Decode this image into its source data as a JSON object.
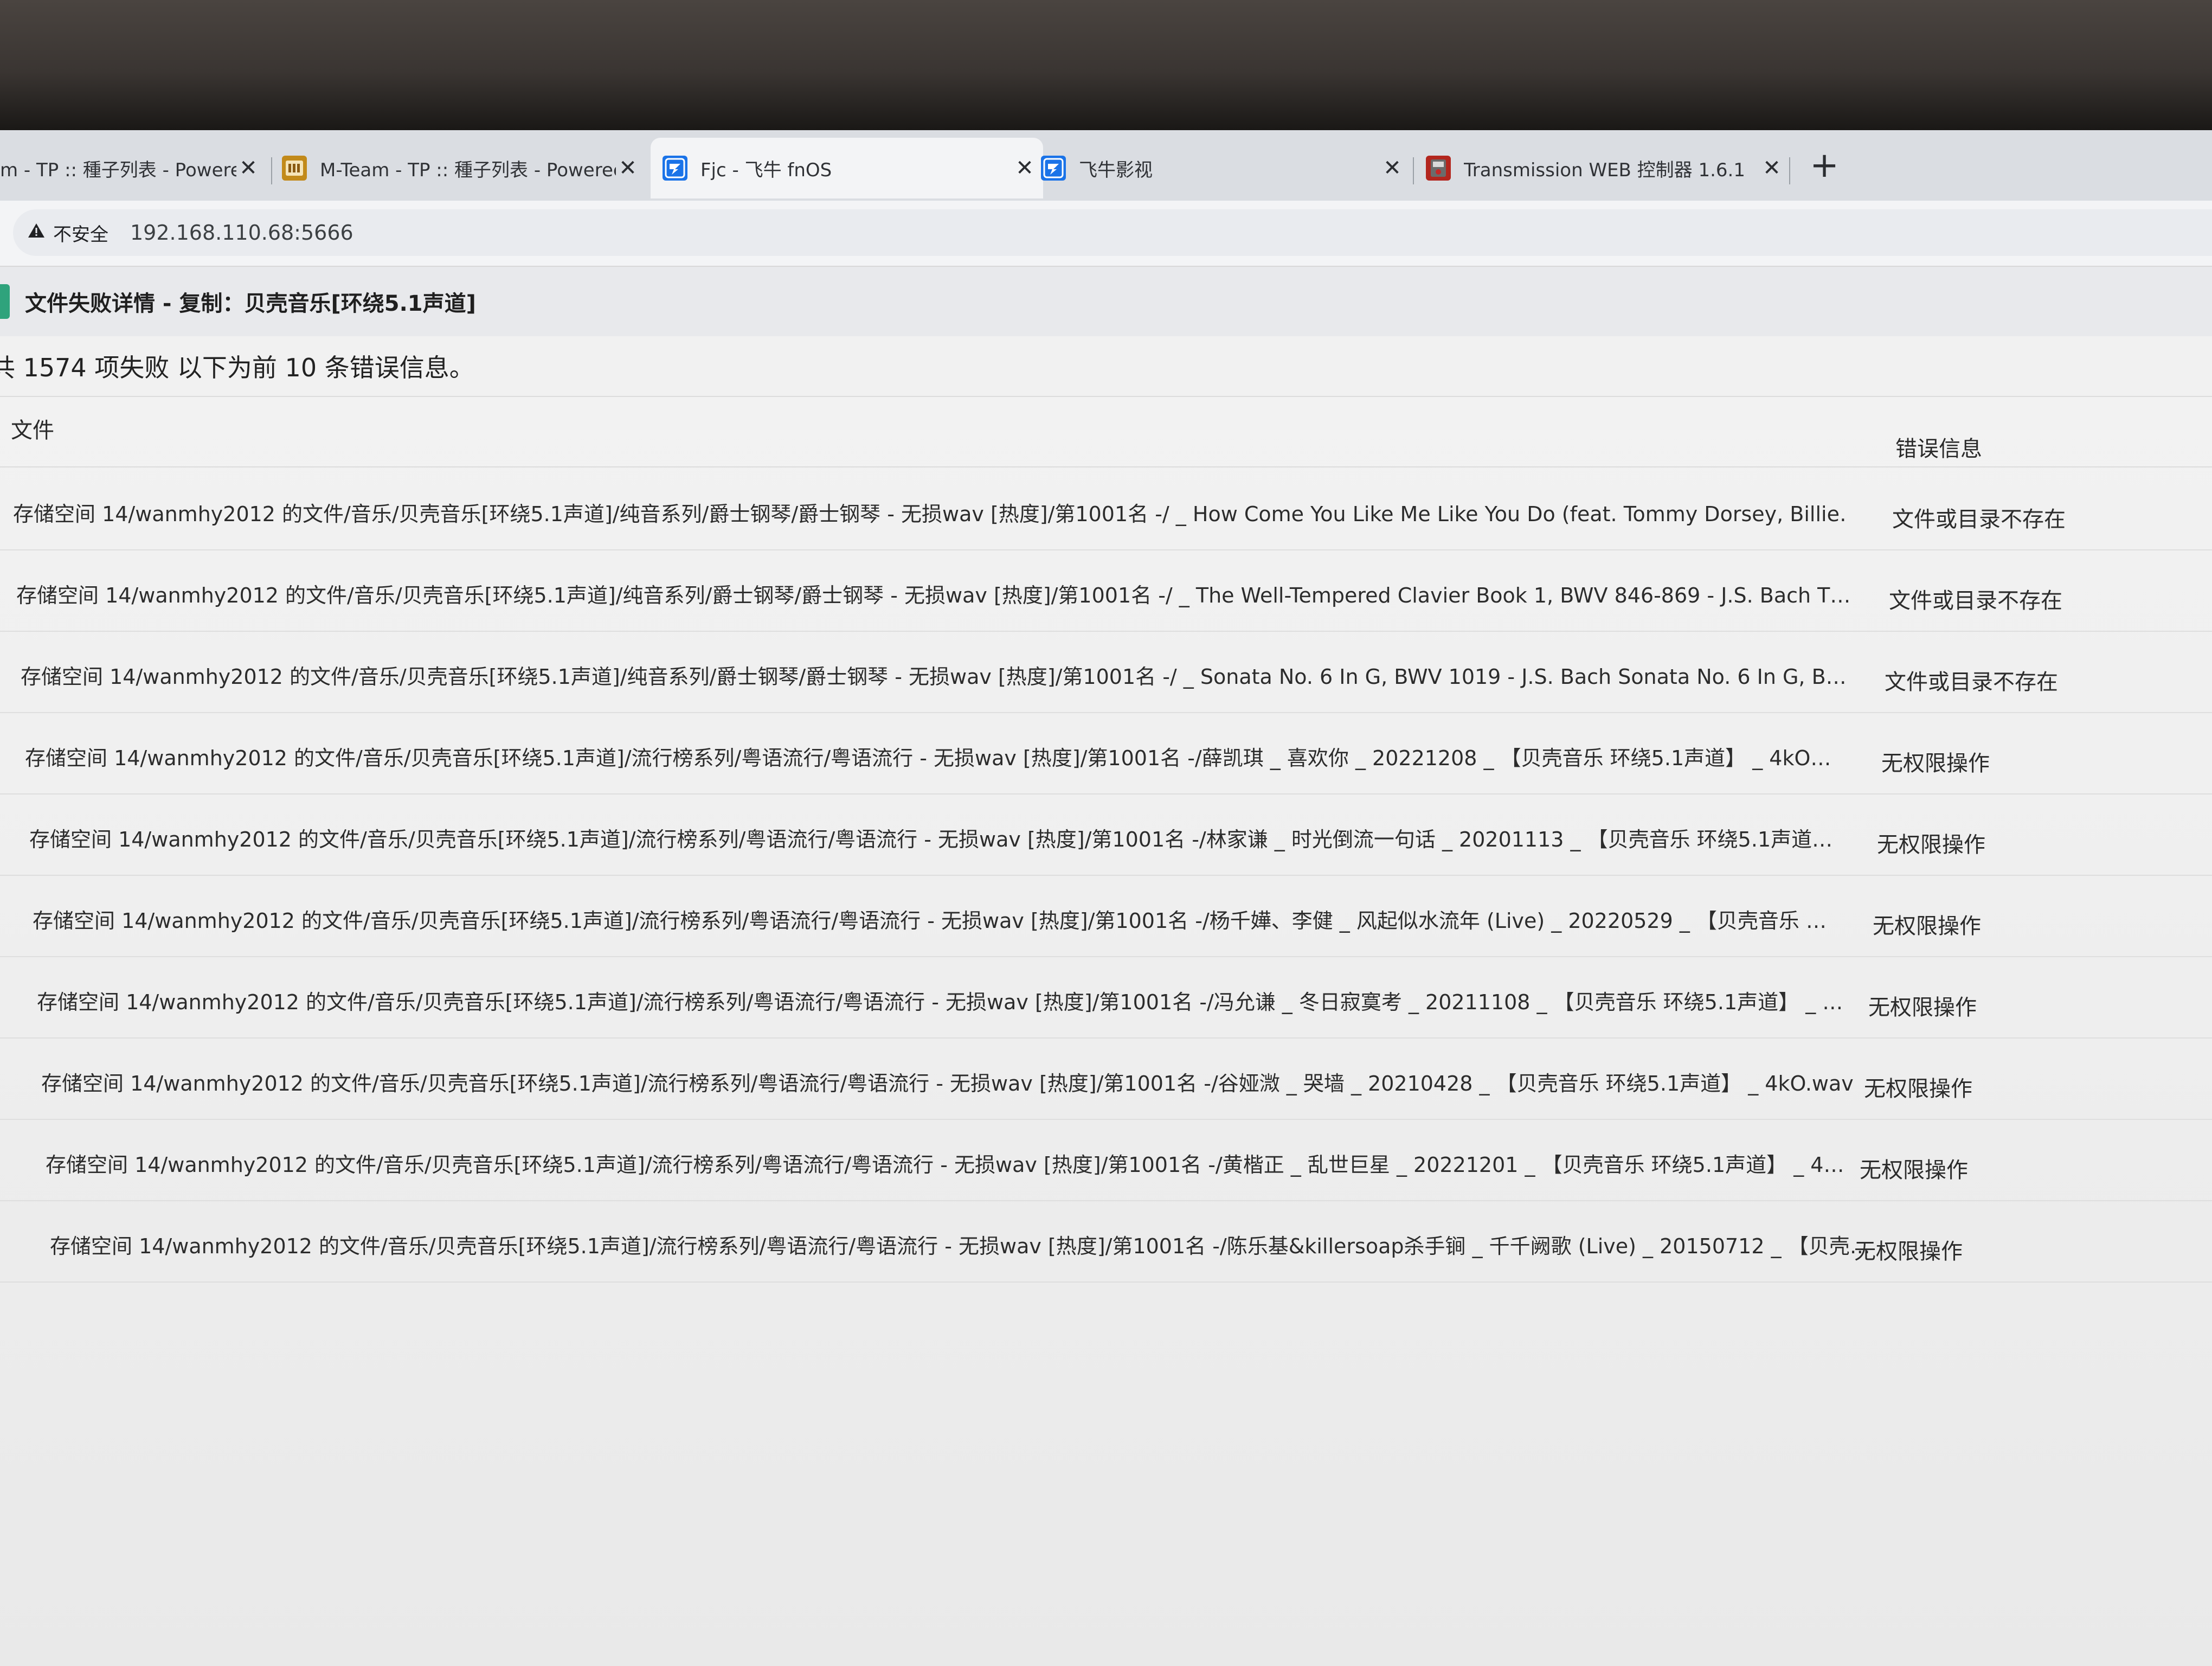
{
  "browser": {
    "tabs": [
      {
        "title": "m - TP :: 種子列表 - Powerec",
        "active": false,
        "icon": "mteam-favicon"
      },
      {
        "title": "M-Team - TP :: 種子列表 - Powerec",
        "active": false,
        "icon": "mteam-favicon"
      },
      {
        "title": "Fjc - 飞牛 fnOS",
        "active": true,
        "icon": "fnos-favicon"
      },
      {
        "title": "飞牛影视",
        "active": false,
        "icon": "fnos-favicon"
      },
      {
        "title": "Transmission WEB 控制器 1.6.1",
        "active": false,
        "icon": "transmission-favicon"
      }
    ],
    "new_tab_label": "+",
    "close_glyph": "✕",
    "security_label": "不安全",
    "url": "192.168.110.68:5666"
  },
  "dialog": {
    "title": "文件失败详情 - 复制：贝壳音乐[环绕5.1声道]",
    "summary": "共 1574 项失败 以下为前 10 条错误信息。",
    "columns": {
      "file": "文件",
      "error": "错误信息"
    },
    "rows": [
      {
        "file": "存储空间 14/wanmhy2012 的文件/音乐/贝壳音乐[环绕5.1声道]/纯音系列/爵士钢琴/爵士钢琴 - 无损wav [热度]/第1001名 -/ _ How Come You Like Me Like You Do (feat. Tommy Dorsey, Billie…",
        "error": "文件或目录不存在"
      },
      {
        "file": "存储空间 14/wanmhy2012 的文件/音乐/贝壳音乐[环绕5.1声道]/纯音系列/爵士钢琴/爵士钢琴 - 无损wav [热度]/第1001名 -/ _ The Well-Tempered Clavier Book 1, BWV 846-869 - J.S. Bach T…",
        "error": "文件或目录不存在"
      },
      {
        "file": "存储空间 14/wanmhy2012 的文件/音乐/贝壳音乐[环绕5.1声道]/纯音系列/爵士钢琴/爵士钢琴 - 无损wav [热度]/第1001名 -/ _ Sonata No. 6 In G, BWV 1019 - J.S. Bach Sonata No. 6 In G, B…",
        "error": "文件或目录不存在"
      },
      {
        "file": "存储空间 14/wanmhy2012 的文件/音乐/贝壳音乐[环绕5.1声道]/流行榜系列/粤语流行/粤语流行 - 无损wav [热度]/第1001名 -/薛凯琪 _ 喜欢你 _ 20221208 _ 【贝壳音乐 环绕5.1声道】 _ 4kO…",
        "error": "无权限操作"
      },
      {
        "file": "存储空间 14/wanmhy2012 的文件/音乐/贝壳音乐[环绕5.1声道]/流行榜系列/粤语流行/粤语流行 - 无损wav [热度]/第1001名 -/林家谦 _ 时光倒流一句话 _ 20201113 _ 【贝壳音乐 环绕5.1声道…",
        "error": "无权限操作"
      },
      {
        "file": "存储空间 14/wanmhy2012 的文件/音乐/贝壳音乐[环绕5.1声道]/流行榜系列/粤语流行/粤语流行 - 无损wav [热度]/第1001名 -/杨千嬅、李健 _ 风起似水流年 (Live) _ 20220529 _ 【贝壳音乐 …",
        "error": "无权限操作"
      },
      {
        "file": "存储空间 14/wanmhy2012 的文件/音乐/贝壳音乐[环绕5.1声道]/流行榜系列/粤语流行/粤语流行 - 无损wav [热度]/第1001名 -/冯允谦 _ 冬日寂寞考 _ 20211108 _ 【贝壳音乐 环绕5.1声道】 _ …",
        "error": "无权限操作"
      },
      {
        "file": "存储空间 14/wanmhy2012 的文件/音乐/贝壳音乐[环绕5.1声道]/流行榜系列/粤语流行/粤语流行 - 无损wav [热度]/第1001名 -/谷娅溦 _ 哭墙 _ 20210428 _ 【贝壳音乐 环绕5.1声道】 _ 4kO.wav",
        "error": "无权限操作"
      },
      {
        "file": "存储空间 14/wanmhy2012 的文件/音乐/贝壳音乐[环绕5.1声道]/流行榜系列/粤语流行/粤语流行 - 无损wav [热度]/第1001名 -/黄楷正 _ 乱世巨星 _ 20221201 _ 【贝壳音乐 环绕5.1声道】 _ 4…",
        "error": "无权限操作"
      },
      {
        "file": "存储空间 14/wanmhy2012 的文件/音乐/贝壳音乐[环绕5.1声道]/流行榜系列/粤语流行/粤语流行 - 无损wav [热度]/第1001名 -/陈乐基&killersoap杀手锏 _ 千千阙歌 (Live) _ 20150712 _ 【贝壳…",
        "error": "无权限操作"
      }
    ]
  },
  "colors": {
    "accent": "#2fa37c",
    "tabstrip": "#dadde2",
    "active_tab": "#f3f4f6",
    "transmission_icon": "#b3261e",
    "fnos_icon": "#1a73e8",
    "mteam_icon": "#c28a1a"
  }
}
